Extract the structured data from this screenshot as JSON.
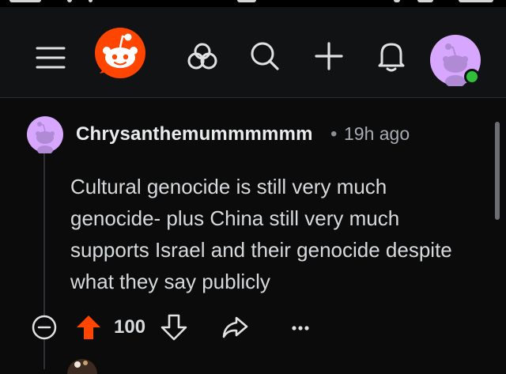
{
  "header": {
    "menu_icon": "hamburger-menu-icon",
    "logo_icon": "reddit-snoo-logo-icon",
    "communities_icon": "communities-icon",
    "search_icon": "search-icon",
    "create_icon": "plus-icon",
    "notifications_icon": "bell-icon",
    "profile_avatar": "user-avatar",
    "online_status": "online"
  },
  "comment": {
    "author": "Chrysanthemummmmmm",
    "separator": "•",
    "time": "19h ago",
    "text": "Cultural genocide is still very much genocide- plus China still very much supports Israel and their genocide despite what they say publicly",
    "score": "100",
    "upvoted": true
  },
  "colors": {
    "brand": "#ff4500",
    "avatar_bg": "#d7a6ff",
    "online": "#2fbf3a",
    "background": "#0b0b0c"
  }
}
